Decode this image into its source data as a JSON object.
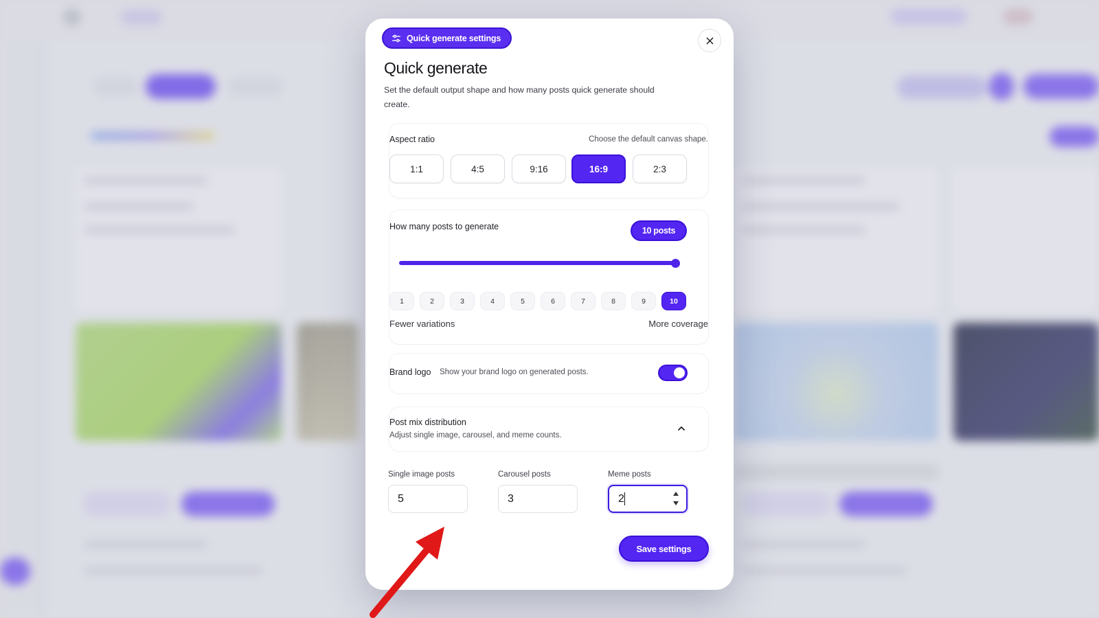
{
  "colors": {
    "accent": "#5426f2",
    "accent_border": "#3a10d8",
    "annotation_arrow": "#e01818"
  },
  "modal": {
    "header_pill_label": "Quick generate settings",
    "header_pill_icon": "sliders-icon",
    "close_icon": "close-icon",
    "title": "Quick generate",
    "description": "Set the default output shape and how many posts quick generate should create."
  },
  "aspect_ratio": {
    "label": "Aspect ratio",
    "hint": "Choose the default canvas shape.",
    "options": [
      "1:1",
      "4:5",
      "9:16",
      "16:9",
      "2:3"
    ],
    "selected": "16:9"
  },
  "post_count": {
    "label": "How many posts to generate",
    "badge": "10 posts",
    "value": 10,
    "min": 1,
    "max": 10,
    "options": [
      "1",
      "2",
      "3",
      "4",
      "5",
      "6",
      "7",
      "8",
      "9",
      "10"
    ],
    "left_caption": "Fewer variations",
    "right_caption": "More coverage"
  },
  "brand_logo": {
    "label": "Brand logo",
    "hint": "Show your brand logo on generated posts.",
    "enabled": true
  },
  "post_mix": {
    "label": "Post mix distribution",
    "hint": "Adjust single image, carousel, and meme counts.",
    "expanded": true,
    "fields": [
      {
        "label": "Single image posts",
        "value": "5"
      },
      {
        "label": "Carousel posts",
        "value": "3"
      },
      {
        "label": "Meme posts",
        "value": "2"
      }
    ]
  },
  "save_label": "Save settings"
}
